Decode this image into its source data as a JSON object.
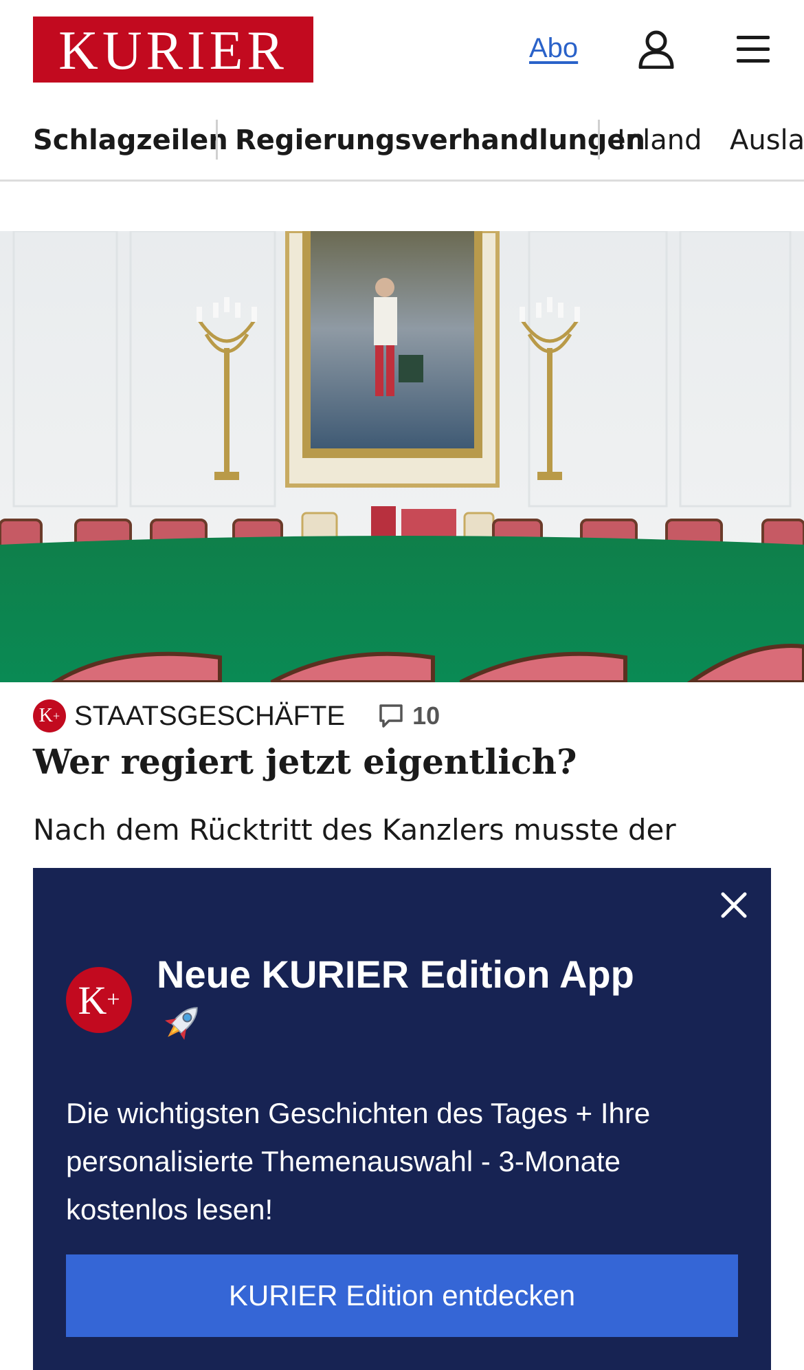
{
  "header": {
    "logo_text": "KURIER",
    "abo_label": "Abo",
    "brand_color": "#c20a1f",
    "icons": [
      "user-icon",
      "menu-icon"
    ]
  },
  "nav": {
    "items": [
      {
        "label": "Schlagzeilen"
      },
      {
        "label": "Regierungsverhandlungen"
      },
      {
        "label": "Inland"
      },
      {
        "label": "Ausland"
      }
    ]
  },
  "article": {
    "badge": "K",
    "badge_plus": "+",
    "category": "STAATSGESCHÄFTE",
    "comment_count": "10",
    "headline": "Wer regiert jetzt eigentlich?",
    "teaser": "Nach dem Rücktritt des Kanzlers musste der"
  },
  "promo": {
    "title": "Neue KURIER Edition App",
    "rocket": "🚀",
    "text": "Die wichtigsten Geschichten des Tages + Ihre personalisierte Themenauswahl - 3-Monate kostenlos lesen!",
    "cta_label": "KURIER Edition entdecken",
    "background_color": "#172353",
    "cta_color": "#3566d6"
  }
}
